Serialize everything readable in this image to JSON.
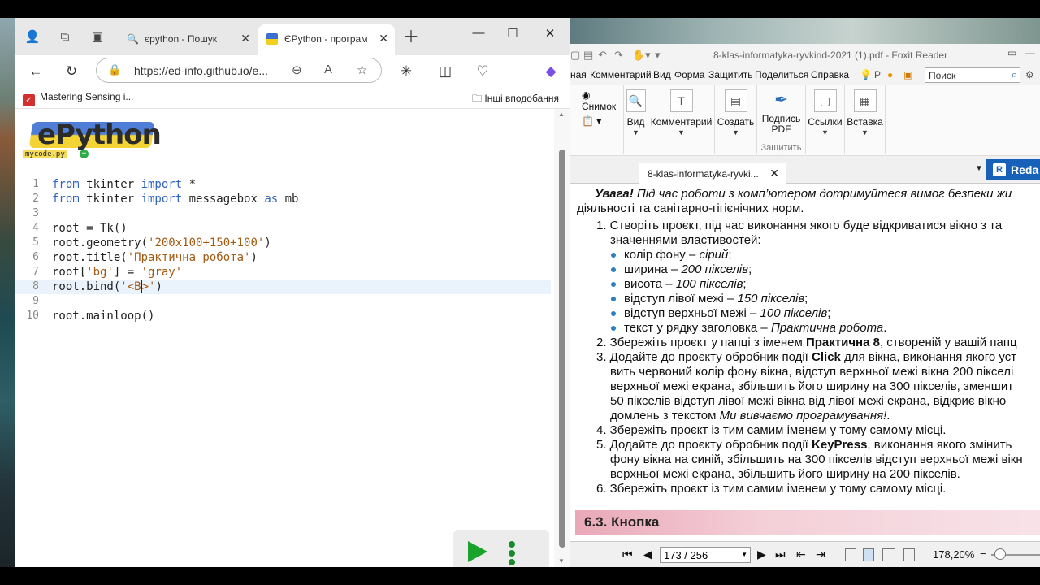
{
  "browser": {
    "tabs": [
      {
        "title": "єpython - Пошук",
        "icon": "search-icon"
      },
      {
        "title": "ЄPython - програм",
        "icon": "epython-flag-icon"
      }
    ],
    "address": {
      "url": "https://ed-info.github.io/e..."
    },
    "bookmarks": {
      "item": "Mastering Sensing i...",
      "other": "Інші вподобання"
    }
  },
  "page": {
    "logo": {
      "text": "ePython",
      "file_label": "mycode.py"
    },
    "code_lines": [
      {
        "n": "1",
        "parts": [
          [
            "kw",
            "from"
          ],
          [
            "t",
            " tkinter "
          ],
          [
            "kw",
            "import"
          ],
          [
            "t",
            " *"
          ]
        ]
      },
      {
        "n": "2",
        "parts": [
          [
            "kw",
            "from"
          ],
          [
            "t",
            " tkinter "
          ],
          [
            "kw",
            "import"
          ],
          [
            "t",
            " messagebox "
          ],
          [
            "kw",
            "as"
          ],
          [
            "t",
            " mb"
          ]
        ]
      },
      {
        "n": "3",
        "parts": []
      },
      {
        "n": "4",
        "parts": [
          [
            "t",
            "root = Tk()"
          ]
        ]
      },
      {
        "n": "5",
        "parts": [
          [
            "t",
            "root.geometry("
          ],
          [
            "s",
            "'200x100+150+100'"
          ],
          [
            "t",
            ")"
          ]
        ]
      },
      {
        "n": "6",
        "parts": [
          [
            "t",
            "root.title("
          ],
          [
            "s",
            "'Практична робота'"
          ],
          [
            "t",
            ")"
          ]
        ]
      },
      {
        "n": "7",
        "parts": [
          [
            "t",
            "root["
          ],
          [
            "s",
            "'bg'"
          ],
          [
            "t",
            "] = "
          ],
          [
            "s",
            "'gray'"
          ]
        ]
      },
      {
        "n": "8",
        "parts": [
          [
            "t",
            "root.bind("
          ],
          [
            "s",
            "'<B"
          ],
          [
            "c",
            ""
          ],
          [
            "s",
            ">'"
          ],
          [
            "t",
            ")"
          ]
        ],
        "highlight": true
      },
      {
        "n": "9",
        "parts": []
      },
      {
        "n": "10",
        "parts": [
          [
            "t",
            "root.mainloop()"
          ]
        ]
      }
    ]
  },
  "foxit": {
    "window_title": "8-klas-informatyka-ryvkind-2021 (1).pdf - Foxit Reader",
    "menu": [
      "ная",
      "Комментарий",
      "Вид",
      "Форма",
      "Защитить",
      "Поделиться",
      "Справка"
    ],
    "search_placeholder": "Поиск",
    "ribbon": {
      "snapshot": "Снимок",
      "view": "Вид",
      "comments": "Комментарий",
      "create": "Создать",
      "sign_pdf": "Подпись PDF",
      "protect_group": "Защитить",
      "links": "Ссылки",
      "insert": "Вставка"
    },
    "doc_tab": "8-klas-informatyka-ryvki...",
    "redact_label": "Reda",
    "page_indicator": "173 / 256",
    "zoom": "178,20%",
    "pdf": {
      "warning_bold": "Увага!",
      "warning_rest": " Під час роботи з комп’ютером дотримуйтеся вимог безпеки жи",
      "warning_line2": "діяльності та санітарно-гігієнічних норм.",
      "item1_a": "1. Створіть проєкт, під час виконання якого буде відкриватися вікно з та",
      "item1_b": "значеннями властивостей:",
      "b1_a": "колір фону – ",
      "b1_b": "сірий",
      "b1_c": ";",
      "b2_a": "ширина – ",
      "b2_b": "200 пікселів",
      "b2_c": ";",
      "b3_a": "висота – ",
      "b3_b": "100 пікселів",
      "b3_c": ";",
      "b4_a": "відступ лівої межі – ",
      "b4_b": "150 пікселів",
      "b4_c": ";",
      "b5_a": "відступ верхньої межі – ",
      "b5_b": "100 пікселів",
      "b5_c": ";",
      "b6_a": "текст у рядку заголовка – ",
      "b6_b": "Практична робота",
      "b6_c": ".",
      "item2_a": "2. Збережіть проєкт у папці з іменем ",
      "item2_b": "Практична 8",
      "item2_c": ", створеній у вашій папц",
      "item3_a": "3. Додайте до проєкту обробник події ",
      "item3_b": "Click",
      "item3_c": " для вікна, виконання якого уст",
      "item3_l2": "вить червоний колір фону вікна, відступ верхньої межі вікна 200 пікселі",
      "item3_l3": "верхньої межі екрана, збільшить його ширину на 300 пікселів, зменшит",
      "item3_l4": "50 пікселів відступ лівої межі вікна від лівої межі екрана, відкриє вікно",
      "item3_l5a": "домлень з текстом ",
      "item3_l5b": "Ми вивчаємо програмування!",
      "item3_l5c": ".",
      "item4": "4. Збережіть проєкт із тим самим іменем у тому самому місці.",
      "item5_a": "5. Додайте до проєкту обробник події ",
      "item5_b": "KeyPress",
      "item5_c": ", виконання якого змінить",
      "item5_l2": "фону вікна на синій, збільшить на 300 пікселів відступ верхньої межі вікн",
      "item5_l3": "верхньої межі екрана, збільшить його ширину на 200 пікселів.",
      "item6": "6. Збережіть проєкт із тим самим іменем у тому самому місці.",
      "section": "6.3.  Кнопка"
    }
  },
  "colors": {
    "keyword": "#2f63c0",
    "string": "#a35b14",
    "run": "#1aa32a",
    "redact": "#1762b8"
  }
}
